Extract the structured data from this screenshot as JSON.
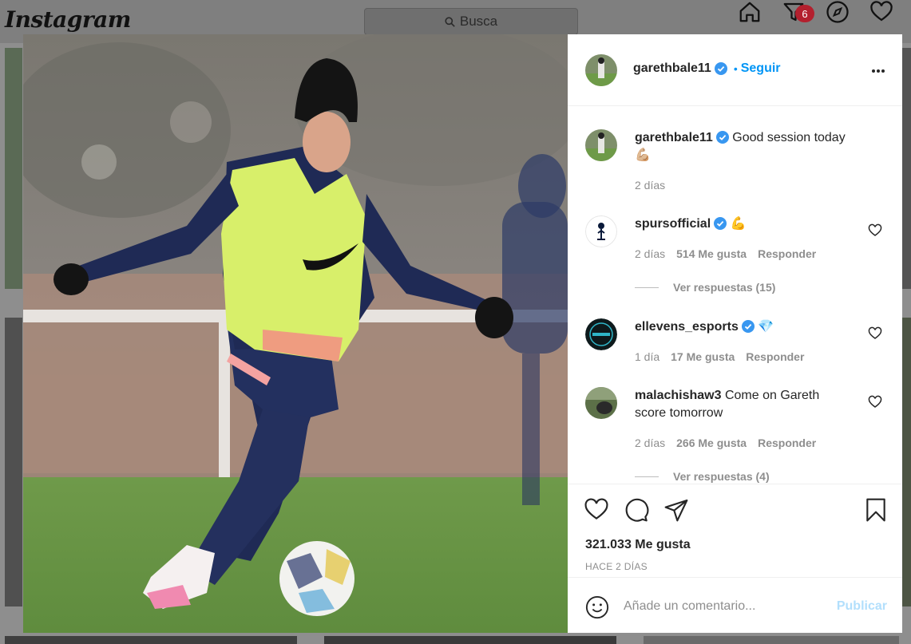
{
  "nav": {
    "logo_text": "Instagram",
    "search_placeholder": "Busca",
    "badge_count": "6",
    "icons": [
      "home-icon",
      "activity-filter-icon",
      "explore-compass-icon",
      "heart-icon"
    ]
  },
  "post": {
    "author": "garethbale11",
    "follow_label": "Seguir",
    "caption": "Good session today",
    "caption_emoji": "💪🏼",
    "caption_time": "2 días",
    "likes": "321.033 Me gusta",
    "posted_ago": "HACE 2 DÍAS"
  },
  "comments": [
    {
      "user": "spursofficial",
      "text": "💪",
      "time": "2 días",
      "likes": "514 Me gusta",
      "reply_label": "Responder",
      "replies": "Ver respuestas (15)"
    },
    {
      "user": "ellevens_esports",
      "text": "💎",
      "time": "1 día",
      "likes": "17 Me gusta",
      "reply_label": "Responder"
    },
    {
      "user": "malachishaw3",
      "text": "Come on Gareth score tomorrow",
      "time": "2 días",
      "likes": "266 Me gusta",
      "reply_label": "Responder",
      "replies": "Ver respuestas (4)"
    }
  ],
  "comment_box": {
    "placeholder": "Añade un comentario...",
    "publish_label": "Publicar"
  },
  "colors": {
    "accent": "#0095f6",
    "publish_disabled": "#b2dffc",
    "verified": "#3897f0",
    "badge": "#ed4956"
  }
}
